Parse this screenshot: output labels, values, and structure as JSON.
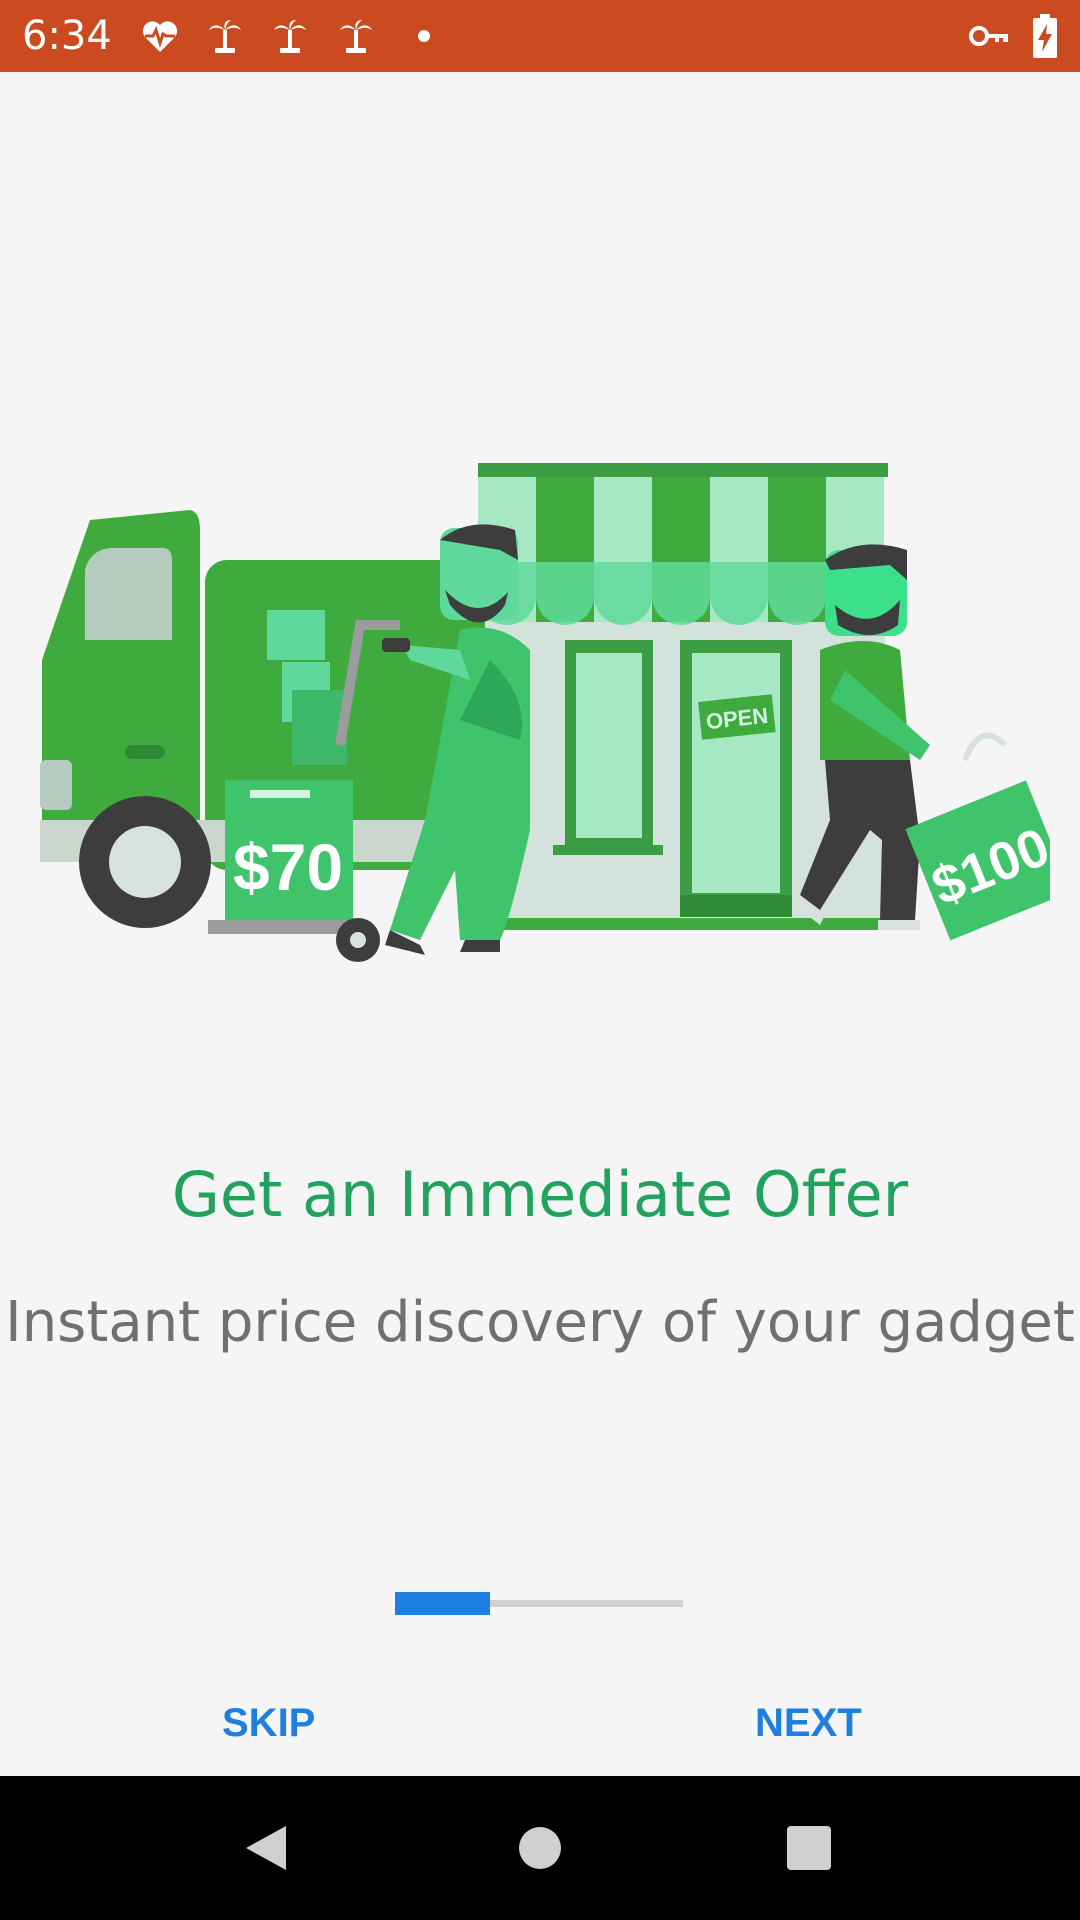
{
  "status_bar": {
    "time": "6:34",
    "left_icons": [
      "heart-pulse-icon",
      "palm-tree-icon",
      "palm-tree-icon",
      "palm-tree-icon",
      "dot-icon"
    ],
    "right_icons": [
      "vpn-key-icon",
      "battery-charging-icon"
    ],
    "color": "#cb4a1f"
  },
  "illustration": {
    "price_left": "$70",
    "price_right": "$100",
    "sign": "OPEN"
  },
  "onboarding": {
    "title": "Get an Immediate Offer",
    "subtitle": "Instant price discovery of your gadget",
    "progress": 0.33
  },
  "actions": {
    "skip_label": "SKIP",
    "next_label": "NEXT"
  },
  "colors": {
    "accent_green": "#22a35d",
    "button_blue": "#1e7fe0",
    "subtitle_gray": "#707070"
  }
}
